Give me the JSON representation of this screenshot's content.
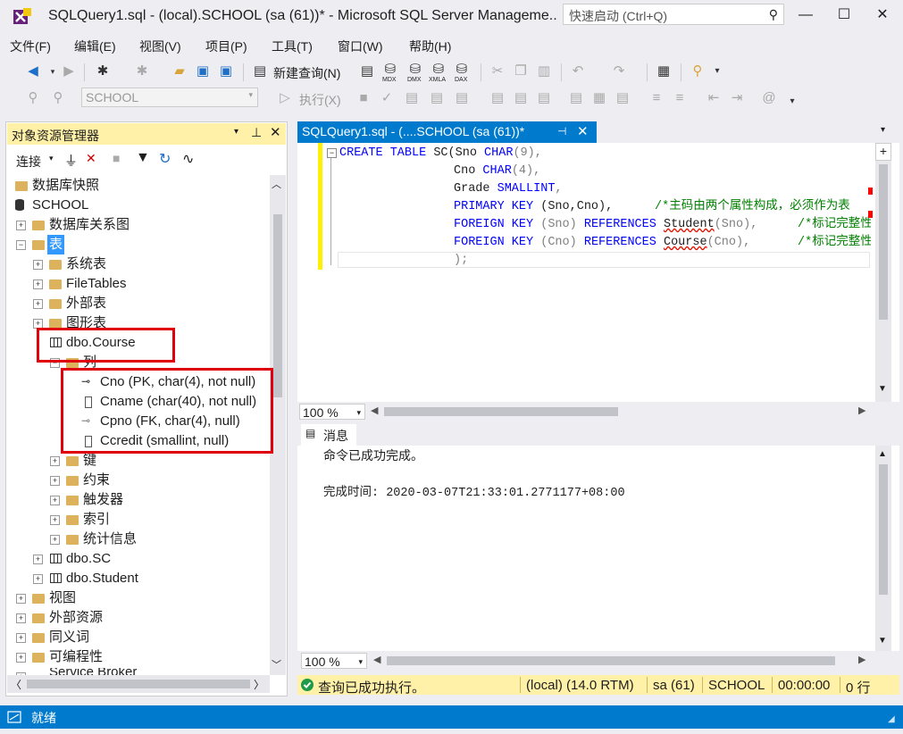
{
  "window": {
    "title": "SQLQuery1.sql - (local).SCHOOL (sa (61))* - Microsoft SQL Server Manageme...",
    "quick_launch_placeholder": "快速启动 (Ctrl+Q)",
    "minimize": "—",
    "maximize": "☐",
    "close": "✕"
  },
  "menu": [
    "文件(F)",
    "编辑(E)",
    "视图(V)",
    "项目(P)",
    "工具(T)",
    "窗口(W)",
    "帮助(H)"
  ],
  "toolbar": {
    "new_query": "新建查询(N)",
    "database": "SCHOOL",
    "execute": "执行(X)",
    "icon_labels": [
      "MDX",
      "DMX",
      "XMLA",
      "DAX"
    ]
  },
  "object_explorer": {
    "title": "对象资源管理器",
    "connect": "连接",
    "tree": {
      "snapshots": "数据库快照",
      "db": "SCHOOL",
      "diagrams": "数据库关系图",
      "tables": "表",
      "system_tables": "系统表",
      "filetables": "FileTables",
      "external_tables": "外部表",
      "graph_tables": "图形表",
      "course": "dbo.Course",
      "columns": "列",
      "col1": "Cno (PK, char(4), not null)",
      "col2": "Cname (char(40), not null)",
      "col3": "Cpno (FK, char(4), null)",
      "col4": "Ccredit (smallint, null)",
      "keys": "键",
      "constraints": "约束",
      "triggers": "触发器",
      "indexes": "索引",
      "statistics": "统计信息",
      "sc": "dbo.SC",
      "student": "dbo.Student",
      "views": "视图",
      "external_resources": "外部资源",
      "synonyms": "同义词",
      "programmability": "可编程性",
      "service_broker": "Service Broker"
    }
  },
  "editor": {
    "tab_label": "SQLQuery1.sql - (....SCHOOL (sa (61))*",
    "zoom": "100 %",
    "code": {
      "l1_kw1": "CREATE TABLE",
      "l1_rest": " SC(Sno ",
      "l1_type": "CHAR",
      "l1_end": "(9),",
      "l2_a": "Cno ",
      "l2_type": "CHAR",
      "l2_end": "(4),",
      "l3_a": "Grade ",
      "l3_type": "SMALLINT",
      "l3_end": ",",
      "l4_kw": "PRIMARY KEY",
      "l4_rest": " (Sno,Cno),",
      "l4_comment": "/*主码由两个属性构成，必须作为表",
      "l5_kw": "FOREIGN KEY",
      "l5_a": " (Sno) ",
      "l5_kw2": "REFERENCES",
      "l5_ref": "Student",
      "l5_end": "(Sno),",
      "l5_comment": "/*标记完整性",
      "l6_kw": "FOREIGN KEY",
      "l6_a": " (Cno) ",
      "l6_kw2": "REFERENCES",
      "l6_ref": "Course",
      "l6_end": "(Cno),",
      "l6_comment": "/*标记完整性",
      "l7": ");"
    }
  },
  "messages": {
    "tab_label": "消息",
    "line1": "命令已成功完成。",
    "line2": "完成时间: 2020-03-07T21:33:01.2771177+08:00",
    "zoom": "100 %"
  },
  "query_status": {
    "message": "查询已成功执行。",
    "server": "(local) (14.0 RTM)",
    "user": "sa (61)",
    "db": "SCHOOL",
    "time": "00:00:00",
    "rows": "0 行"
  },
  "statusbar": {
    "text": "就绪"
  },
  "colors": {
    "accent": "#007acc",
    "highlight_yellow": "#fff1a7",
    "annotation_red": "#e0000d"
  }
}
